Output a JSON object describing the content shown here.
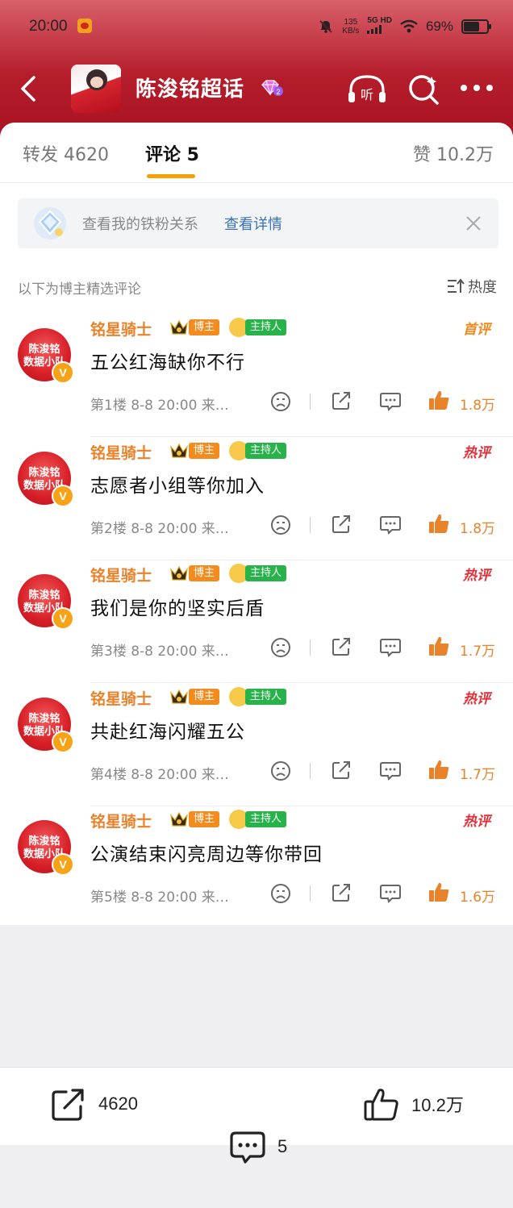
{
  "status": {
    "time": "20:00",
    "speed_top": "135",
    "speed_bottom": "KB/s",
    "network_top": "5G HD",
    "battery": "69%"
  },
  "header": {
    "title": "陈浚铭超话",
    "gem_level": "2"
  },
  "tabs": {
    "repost": "转发 4620",
    "comment": "评论 5",
    "like": "赞 10.2万"
  },
  "fan_banner": {
    "text": "查看我的铁粉关系",
    "link": "查看详情"
  },
  "list_header": {
    "selected_label": "以下为博主精选评论",
    "sort_label": "热度"
  },
  "avatar_text": {
    "line1": "陈浚铭",
    "line2": "数据小队"
  },
  "comments": [
    {
      "name": "铭星骑士",
      "badge_host": "博主",
      "badge_mod": "主持人",
      "tag": "首评",
      "text": "五公红海缺你不行",
      "meta": "第1楼 8-8 20:00 来…",
      "likes": "1.8万"
    },
    {
      "name": "铭星骑士",
      "badge_host": "博主",
      "badge_mod": "主持人",
      "tag": "热评",
      "text": "志愿者小组等你加入",
      "meta": "第2楼 8-8 20:00 来…",
      "likes": "1.8万"
    },
    {
      "name": "铭星骑士",
      "badge_host": "博主",
      "badge_mod": "主持人",
      "tag": "热评",
      "text": "我们是你的坚实后盾",
      "meta": "第3楼 8-8 20:00 来…",
      "likes": "1.7万"
    },
    {
      "name": "铭星骑士",
      "badge_host": "博主",
      "badge_mod": "主持人",
      "tag": "热评",
      "text": "共赴红海闪耀五公",
      "meta": "第4楼 8-8 20:00 来…",
      "likes": "1.7万"
    },
    {
      "name": "铭星骑士",
      "badge_host": "博主",
      "badge_mod": "主持人",
      "tag": "热评",
      "text": "公演结束闪亮周边等你带回",
      "meta": "第5楼 8-8 20:00 来…",
      "likes": "1.6万"
    }
  ],
  "bottom_bar": {
    "repost_count": "4620",
    "comment_count": "5",
    "like_count": "10.2万"
  },
  "colors": {
    "header_red": "#b51d2b",
    "accent_orange": "#e8832c",
    "hot_red": "#e0313a",
    "link_blue": "#3a72b8"
  }
}
